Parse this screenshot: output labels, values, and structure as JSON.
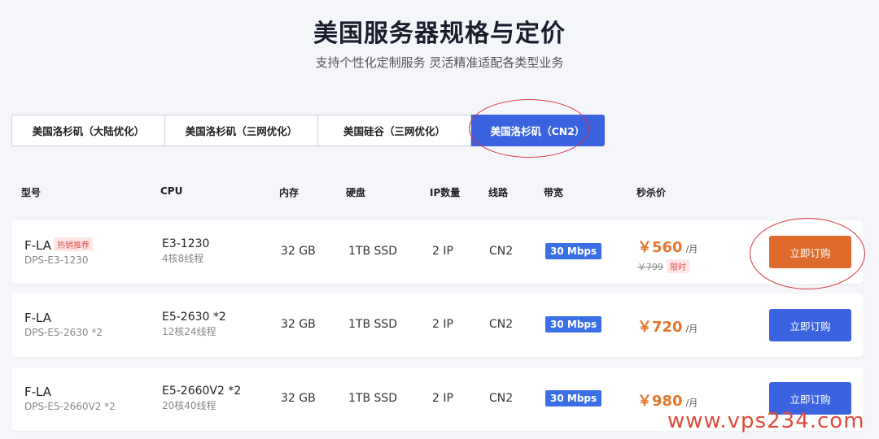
{
  "page": {
    "title": "美国服务器规格与定价",
    "subtitle": "支持个性化定制服务 灵活精准适配各类型业务"
  },
  "tabs": [
    {
      "label": "美国洛杉矶（大陆优化）",
      "active": false
    },
    {
      "label": "美国洛杉矶（三网优化）",
      "active": false
    },
    {
      "label": "美国硅谷（三网优化）",
      "active": false
    },
    {
      "label": "美国洛杉矶（CN2）",
      "active": true
    }
  ],
  "columns": {
    "model": "型号",
    "cpu": "CPU",
    "memory": "内存",
    "disk": "硬盘",
    "ip": "IP数量",
    "line": "线路",
    "bandwidth": "带宽",
    "price": "秒杀价"
  },
  "products": [
    {
      "model": "F-LA",
      "badge": "热销推荐",
      "code": "DPS-E3-1230",
      "cpu": "E3-1230",
      "cpu_desc": "4核8线程",
      "memory": "32 GB",
      "disk": "1TB SSD",
      "ip": "2 IP",
      "line": "CN2",
      "bandwidth": "30 Mbps",
      "price": "￥560",
      "per": "/月",
      "old_price": "￥799",
      "limit_badge": "限时",
      "buy_label": "立即订购"
    },
    {
      "model": "F-LA",
      "code": "DPS-E5-2630 *2",
      "cpu": "E5-2630 *2",
      "cpu_desc": "12核24线程",
      "memory": "32 GB",
      "disk": "1TB SSD",
      "ip": "2 IP",
      "line": "CN2",
      "bandwidth": "30 Mbps",
      "price": "￥720",
      "per": "/月",
      "buy_label": "立即订购"
    },
    {
      "model": "F-LA",
      "code": "DPS-E5-2660V2 *2",
      "cpu": "E5-2660V2 *2",
      "cpu_desc": "20核40线程",
      "memory": "32 GB",
      "disk": "1TB SSD",
      "ip": "2 IP",
      "line": "CN2",
      "bandwidth": "30 Mbps",
      "price": "￥980",
      "per": "/月",
      "buy_label": "立即订购"
    }
  ],
  "watermark": "www.vps234.com",
  "colors": {
    "accent": "#3b63e0",
    "price": "#e2762e",
    "highlight_button": "#de6b2c",
    "annotation_circle": "#d9363e"
  }
}
